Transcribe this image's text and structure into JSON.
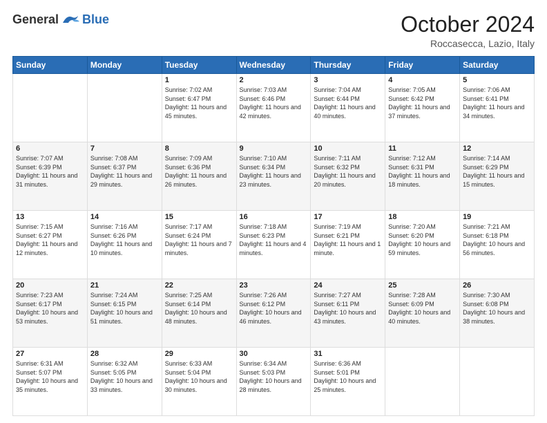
{
  "header": {
    "logo": {
      "general": "General",
      "blue": "Blue"
    },
    "title": "October 2024",
    "location": "Roccasecca, Lazio, Italy"
  },
  "weekdays": [
    "Sunday",
    "Monday",
    "Tuesday",
    "Wednesday",
    "Thursday",
    "Friday",
    "Saturday"
  ],
  "weeks": [
    [
      null,
      null,
      {
        "day": "1",
        "sunrise": "Sunrise: 7:02 AM",
        "sunset": "Sunset: 6:47 PM",
        "daylight": "Daylight: 11 hours and 45 minutes."
      },
      {
        "day": "2",
        "sunrise": "Sunrise: 7:03 AM",
        "sunset": "Sunset: 6:46 PM",
        "daylight": "Daylight: 11 hours and 42 minutes."
      },
      {
        "day": "3",
        "sunrise": "Sunrise: 7:04 AM",
        "sunset": "Sunset: 6:44 PM",
        "daylight": "Daylight: 11 hours and 40 minutes."
      },
      {
        "day": "4",
        "sunrise": "Sunrise: 7:05 AM",
        "sunset": "Sunset: 6:42 PM",
        "daylight": "Daylight: 11 hours and 37 minutes."
      },
      {
        "day": "5",
        "sunrise": "Sunrise: 7:06 AM",
        "sunset": "Sunset: 6:41 PM",
        "daylight": "Daylight: 11 hours and 34 minutes."
      }
    ],
    [
      {
        "day": "6",
        "sunrise": "Sunrise: 7:07 AM",
        "sunset": "Sunset: 6:39 PM",
        "daylight": "Daylight: 11 hours and 31 minutes."
      },
      {
        "day": "7",
        "sunrise": "Sunrise: 7:08 AM",
        "sunset": "Sunset: 6:37 PM",
        "daylight": "Daylight: 11 hours and 29 minutes."
      },
      {
        "day": "8",
        "sunrise": "Sunrise: 7:09 AM",
        "sunset": "Sunset: 6:36 PM",
        "daylight": "Daylight: 11 hours and 26 minutes."
      },
      {
        "day": "9",
        "sunrise": "Sunrise: 7:10 AM",
        "sunset": "Sunset: 6:34 PM",
        "daylight": "Daylight: 11 hours and 23 minutes."
      },
      {
        "day": "10",
        "sunrise": "Sunrise: 7:11 AM",
        "sunset": "Sunset: 6:32 PM",
        "daylight": "Daylight: 11 hours and 20 minutes."
      },
      {
        "day": "11",
        "sunrise": "Sunrise: 7:12 AM",
        "sunset": "Sunset: 6:31 PM",
        "daylight": "Daylight: 11 hours and 18 minutes."
      },
      {
        "day": "12",
        "sunrise": "Sunrise: 7:14 AM",
        "sunset": "Sunset: 6:29 PM",
        "daylight": "Daylight: 11 hours and 15 minutes."
      }
    ],
    [
      {
        "day": "13",
        "sunrise": "Sunrise: 7:15 AM",
        "sunset": "Sunset: 6:27 PM",
        "daylight": "Daylight: 11 hours and 12 minutes."
      },
      {
        "day": "14",
        "sunrise": "Sunrise: 7:16 AM",
        "sunset": "Sunset: 6:26 PM",
        "daylight": "Daylight: 11 hours and 10 minutes."
      },
      {
        "day": "15",
        "sunrise": "Sunrise: 7:17 AM",
        "sunset": "Sunset: 6:24 PM",
        "daylight": "Daylight: 11 hours and 7 minutes."
      },
      {
        "day": "16",
        "sunrise": "Sunrise: 7:18 AM",
        "sunset": "Sunset: 6:23 PM",
        "daylight": "Daylight: 11 hours and 4 minutes."
      },
      {
        "day": "17",
        "sunrise": "Sunrise: 7:19 AM",
        "sunset": "Sunset: 6:21 PM",
        "daylight": "Daylight: 11 hours and 1 minute."
      },
      {
        "day": "18",
        "sunrise": "Sunrise: 7:20 AM",
        "sunset": "Sunset: 6:20 PM",
        "daylight": "Daylight: 10 hours and 59 minutes."
      },
      {
        "day": "19",
        "sunrise": "Sunrise: 7:21 AM",
        "sunset": "Sunset: 6:18 PM",
        "daylight": "Daylight: 10 hours and 56 minutes."
      }
    ],
    [
      {
        "day": "20",
        "sunrise": "Sunrise: 7:23 AM",
        "sunset": "Sunset: 6:17 PM",
        "daylight": "Daylight: 10 hours and 53 minutes."
      },
      {
        "day": "21",
        "sunrise": "Sunrise: 7:24 AM",
        "sunset": "Sunset: 6:15 PM",
        "daylight": "Daylight: 10 hours and 51 minutes."
      },
      {
        "day": "22",
        "sunrise": "Sunrise: 7:25 AM",
        "sunset": "Sunset: 6:14 PM",
        "daylight": "Daylight: 10 hours and 48 minutes."
      },
      {
        "day": "23",
        "sunrise": "Sunrise: 7:26 AM",
        "sunset": "Sunset: 6:12 PM",
        "daylight": "Daylight: 10 hours and 46 minutes."
      },
      {
        "day": "24",
        "sunrise": "Sunrise: 7:27 AM",
        "sunset": "Sunset: 6:11 PM",
        "daylight": "Daylight: 10 hours and 43 minutes."
      },
      {
        "day": "25",
        "sunrise": "Sunrise: 7:28 AM",
        "sunset": "Sunset: 6:09 PM",
        "daylight": "Daylight: 10 hours and 40 minutes."
      },
      {
        "day": "26",
        "sunrise": "Sunrise: 7:30 AM",
        "sunset": "Sunset: 6:08 PM",
        "daylight": "Daylight: 10 hours and 38 minutes."
      }
    ],
    [
      {
        "day": "27",
        "sunrise": "Sunrise: 6:31 AM",
        "sunset": "Sunset: 5:07 PM",
        "daylight": "Daylight: 10 hours and 35 minutes."
      },
      {
        "day": "28",
        "sunrise": "Sunrise: 6:32 AM",
        "sunset": "Sunset: 5:05 PM",
        "daylight": "Daylight: 10 hours and 33 minutes."
      },
      {
        "day": "29",
        "sunrise": "Sunrise: 6:33 AM",
        "sunset": "Sunset: 5:04 PM",
        "daylight": "Daylight: 10 hours and 30 minutes."
      },
      {
        "day": "30",
        "sunrise": "Sunrise: 6:34 AM",
        "sunset": "Sunset: 5:03 PM",
        "daylight": "Daylight: 10 hours and 28 minutes."
      },
      {
        "day": "31",
        "sunrise": "Sunrise: 6:36 AM",
        "sunset": "Sunset: 5:01 PM",
        "daylight": "Daylight: 10 hours and 25 minutes."
      },
      null,
      null
    ]
  ]
}
